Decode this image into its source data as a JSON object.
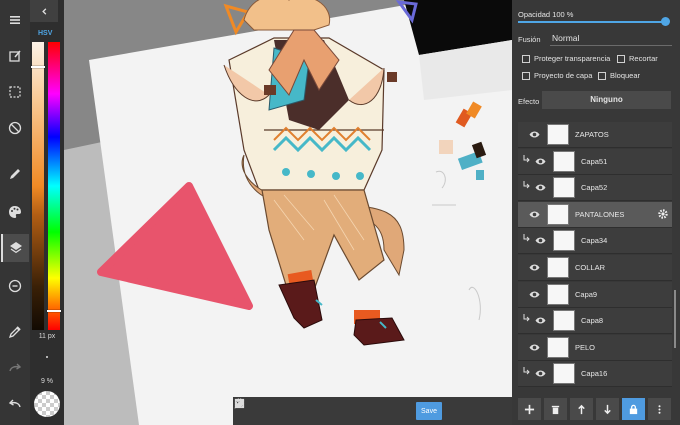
{
  "left_toolbar": {
    "tools": [
      "menu-icon",
      "edit-icon",
      "selection-icon",
      "no-draw-icon",
      "brush-icon",
      "palette-icon",
      "layers-icon",
      "circle-icon",
      "eyedropper-icon",
      "redo-icon",
      "undo-icon"
    ]
  },
  "color_panel": {
    "mode_label": "HSV",
    "brush_size": "11 px",
    "opacity": "9 %"
  },
  "bottom_toolbar": {
    "save_label": "Save"
  },
  "layer_panel": {
    "opacity_label": "Opacidad 100 %",
    "opacity_value": 100,
    "blend_label": "Fusión",
    "blend_value": "Normal",
    "checkboxes": {
      "protect_transparency": "Proteger transparencia",
      "clip": "Recortar",
      "layer_project": "Proyecto de capa",
      "lock": "Bloquear"
    },
    "effect_label": "Efecto",
    "effect_value": "Ninguno",
    "layers": [
      {
        "name": "ZAPATOS",
        "clipped": false,
        "selected": false
      },
      {
        "name": "Capa51",
        "clipped": true,
        "selected": false
      },
      {
        "name": "Capa52",
        "clipped": true,
        "selected": false
      },
      {
        "name": "PANTALONES",
        "clipped": false,
        "selected": true
      },
      {
        "name": "Capa34",
        "clipped": true,
        "selected": false
      },
      {
        "name": "COLLAR",
        "clipped": false,
        "selected": false
      },
      {
        "name": "Capa9",
        "clipped": false,
        "selected": false
      },
      {
        "name": "Capa8",
        "clipped": true,
        "selected": false
      },
      {
        "name": "PELO",
        "clipped": false,
        "selected": false
      },
      {
        "name": "Capa16",
        "clipped": true,
        "selected": false
      }
    ]
  },
  "colors": {
    "accent": "#4f9be0",
    "primary_color": "#f08a25",
    "shape_pink": "#e8546c"
  }
}
